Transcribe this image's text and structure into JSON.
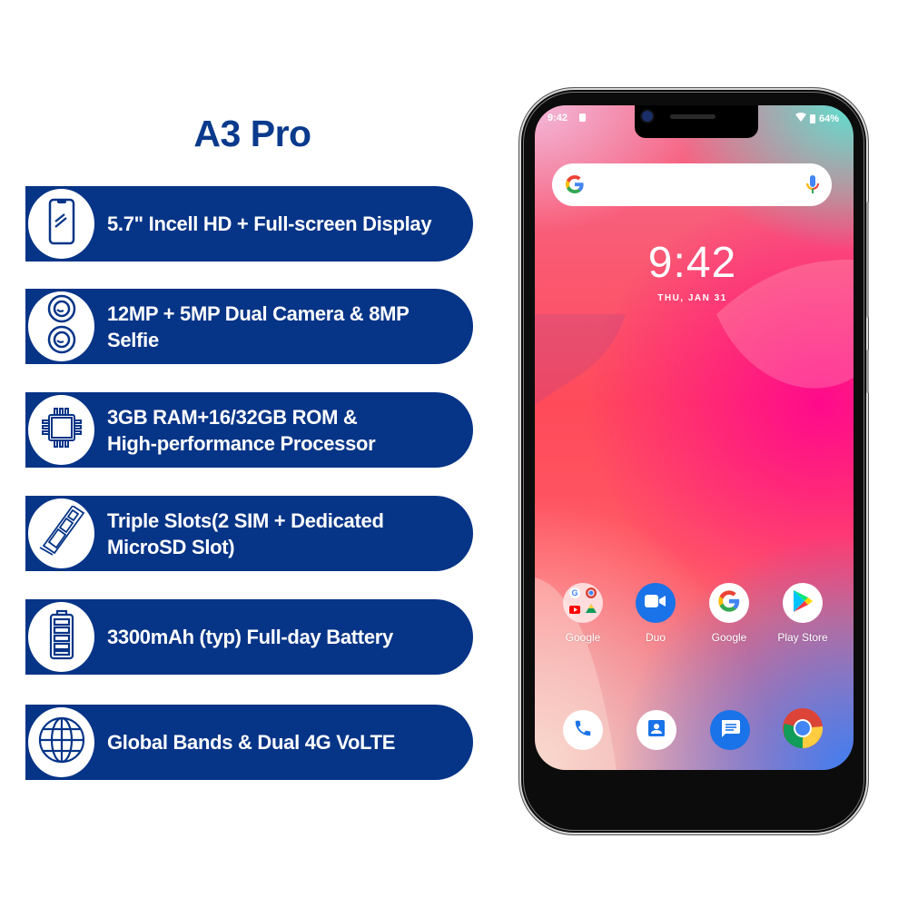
{
  "title": "A3 Pro",
  "features": [
    {
      "icon": "smartphone-icon",
      "lines": [
        "5.7\" Incell HD + Full-screen Display"
      ]
    },
    {
      "icon": "dual-camera-icon",
      "lines": [
        "12MP + 5MP Dual Camera & 8MP",
        "Selfie"
      ]
    },
    {
      "icon": "processor-chip-icon",
      "lines": [
        "3GB RAM+16/32GB ROM &",
        "High-performance Processor"
      ]
    },
    {
      "icon": "sim-tray-icon",
      "lines": [
        "Triple Slots(2 SIM + Dedicated",
        "MicroSD Slot)"
      ]
    },
    {
      "icon": "battery-icon",
      "lines": [
        "3300mAh (typ) Full-day Battery"
      ]
    },
    {
      "icon": "globe-icon",
      "lines": [
        "Global Bands & Dual 4G VoLTE"
      ]
    }
  ],
  "colors": {
    "brand_blue": "#063487",
    "title_blue": "#0a3a8c"
  },
  "phone": {
    "status_bar": {
      "time": "9:42",
      "battery": "64%"
    },
    "clock": "9:42",
    "date": "THU, JAN 31",
    "apps": [
      {
        "label": "Google",
        "icon": "google-folder-icon"
      },
      {
        "label": "Duo",
        "icon": "duo-icon"
      },
      {
        "label": "Google",
        "icon": "google-icon"
      },
      {
        "label": "Play Store",
        "icon": "play-store-icon"
      }
    ],
    "dock": [
      {
        "icon": "phone-icon"
      },
      {
        "icon": "contacts-icon"
      },
      {
        "icon": "messages-icon"
      },
      {
        "icon": "chrome-icon"
      }
    ]
  }
}
